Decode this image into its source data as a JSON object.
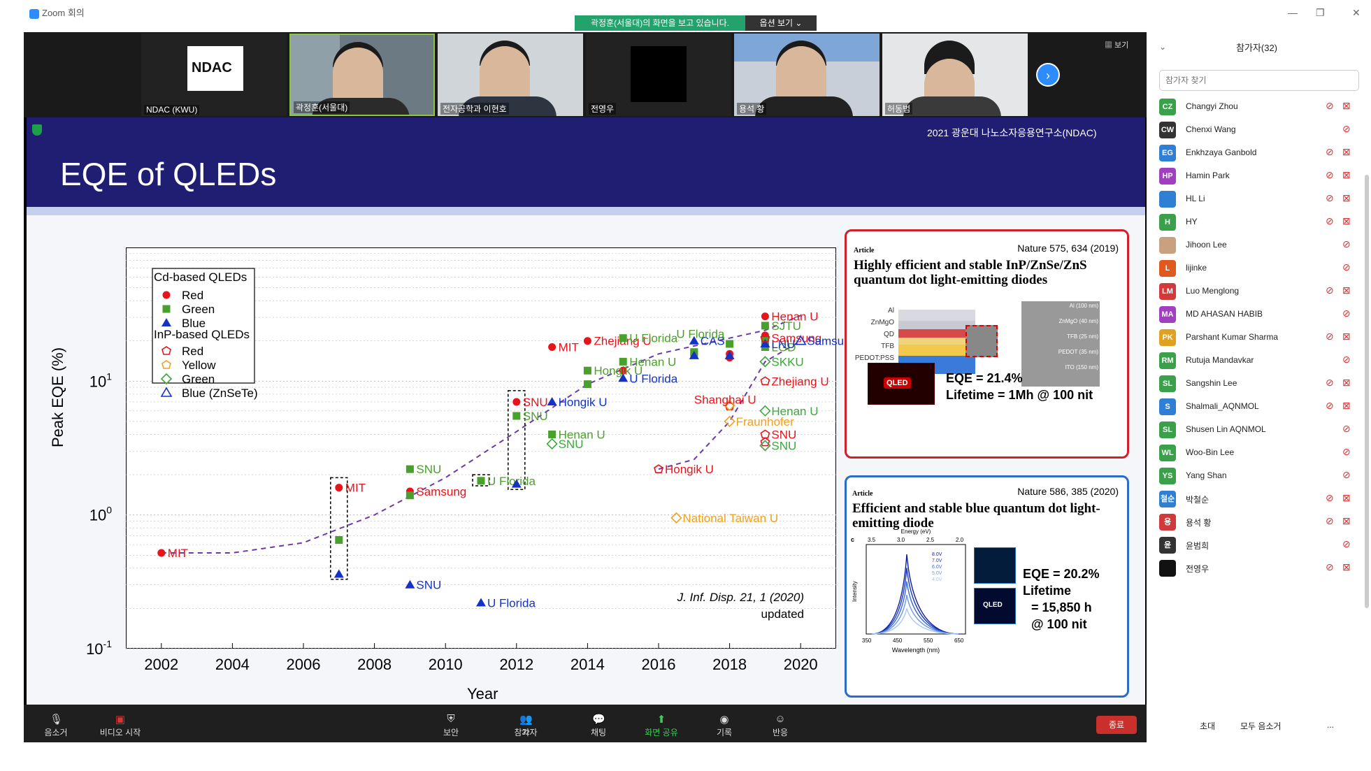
{
  "window": {
    "title": "Zoom 회의",
    "banner": "곽정훈(서울대)의 화면을 보고 있습니다.",
    "view_options": "옵션 보기 ⌄",
    "min": "—",
    "max": "❐",
    "close": "✕"
  },
  "gallery": {
    "view_label": "▦ 보기",
    "tiles": [
      {
        "name": "NDAC (KWU)",
        "logo": "NDAC"
      },
      {
        "name": "곽정훈(서울대)"
      },
      {
        "name": "전자공학과 이현호"
      },
      {
        "name": "전영우"
      },
      {
        "name": "용석 황"
      },
      {
        "name": "허동범"
      }
    ],
    "next": "›"
  },
  "slide": {
    "title": "EQE of QLEDs",
    "org": "2021 광운대 나노소자응용연구소(NDAC)"
  },
  "chart_data": {
    "type": "scatter",
    "xlabel": "Year",
    "ylabel": "Peak EQE (%)",
    "xlim": [
      2001,
      2021
    ],
    "xticks": [
      2002,
      2004,
      2006,
      2008,
      2010,
      2012,
      2014,
      2016,
      2018,
      2020
    ],
    "ylim": [
      0.1,
      100
    ],
    "log_y": true,
    "ytick_labels": [
      {
        "v": 10,
        "t": "10",
        "e": "1"
      },
      {
        "v": 1,
        "t": "10",
        "e": "0"
      },
      {
        "v": 0.1,
        "t": "10",
        "e": "-1"
      }
    ],
    "legend": {
      "title1": "Cd-based QLEDs",
      "cd": [
        "Red",
        "Green",
        "Blue"
      ],
      "title2": "InP-based QLEDs",
      "inp": [
        "Red",
        "Yellow",
        "Green"
      ],
      "extra": "Blue (ZnSeTe)"
    },
    "citation": "J. Inf. Disp. 21, 1 (2020)",
    "citation_note": "updated",
    "series": [
      {
        "name": "Red",
        "marker": "circle",
        "color": "#e8141c",
        "points": [
          [
            2002,
            0.52,
            "MIT"
          ],
          [
            2007,
            1.6,
            "MIT"
          ],
          [
            2009,
            1.5,
            "Samsung"
          ],
          [
            2012,
            7,
            "SNU"
          ],
          [
            2013,
            18,
            "MIT"
          ],
          [
            2014,
            20,
            "Zhejiang U"
          ],
          [
            2015,
            12,
            ""
          ],
          [
            2018,
            16,
            ""
          ],
          [
            2018,
            15,
            ""
          ],
          [
            2019,
            30.5,
            "Henan U"
          ],
          [
            2019,
            22,
            ""
          ]
        ]
      },
      {
        "name": "Green",
        "marker": "square",
        "color": "#4aa02c",
        "points": [
          [
            2007,
            0.65,
            ""
          ],
          [
            2009,
            1.4,
            ""
          ],
          [
            2009,
            2.2,
            "SNU"
          ],
          [
            2011,
            1.8,
            "U Florida"
          ],
          [
            2012,
            5.5,
            "SNU"
          ],
          [
            2013,
            4,
            "Henan U"
          ],
          [
            2014,
            12,
            "Hongik U"
          ],
          [
            2014,
            9.5,
            ""
          ],
          [
            2015,
            21,
            "U Florida"
          ],
          [
            2015,
            14,
            "Henan U"
          ],
          [
            2017,
            16,
            ""
          ],
          [
            2017,
            16.5,
            ""
          ],
          [
            2018,
            19,
            ""
          ],
          [
            2019,
            26,
            "SJTU"
          ],
          [
            2019,
            20,
            ""
          ],
          [
            2019,
            18,
            "LGD"
          ]
        ]
      },
      {
        "name": "Blue",
        "marker": "triangle",
        "color": "#1532c8",
        "points": [
          [
            2007,
            0.36,
            ""
          ],
          [
            2009,
            0.3,
            "SNU"
          ],
          [
            2011,
            0.22,
            "U Florida"
          ],
          [
            2012,
            1.7,
            ""
          ],
          [
            2013,
            7,
            "Hongik U"
          ],
          [
            2015,
            10.5,
            "U Florida"
          ],
          [
            2017,
            20,
            "CAS"
          ],
          [
            2017,
            15.5,
            ""
          ],
          [
            2018,
            15.5,
            ""
          ],
          [
            2019,
            19,
            "LNU"
          ]
        ]
      },
      {
        "name": "InP Red",
        "marker": "pentagon",
        "color": "#e8141c",
        "points": [
          [
            2016,
            2.2,
            "Hongik U"
          ],
          [
            2018,
            6.5,
            ""
          ],
          [
            2019,
            4,
            "SNU"
          ],
          [
            2019,
            3.5,
            ""
          ],
          [
            2019,
            10,
            "Zhejiang U"
          ],
          [
            2019,
            21,
            "Samsung"
          ]
        ]
      },
      {
        "name": "InP Yellow",
        "marker": "diamond",
        "color": "#f0a020",
        "points": [
          [
            2018,
            6.6,
            ""
          ],
          [
            2018,
            5,
            "Fraunhofer"
          ],
          [
            2016.5,
            0.95,
            "National Taiwan U"
          ]
        ]
      },
      {
        "name": "InP Green",
        "marker": "diamond",
        "color": "#3aa83a",
        "points": [
          [
            2013,
            3.4,
            "SNU"
          ],
          [
            2019,
            6,
            "Henan U"
          ],
          [
            2019,
            3.3,
            "SNU"
          ],
          [
            2019,
            14,
            "SKKU"
          ]
        ]
      },
      {
        "name": "Blue (ZnSeTe)",
        "marker": "open-triangle",
        "color": "#1532c8",
        "points": [
          [
            2020,
            20,
            "Samsung"
          ]
        ]
      }
    ],
    "text_labels": [
      {
        "text": "Shanghai U",
        "x": 2017,
        "y": 6.8,
        "color": "#e8141c"
      },
      {
        "text": "U Florida",
        "x": 2016.5,
        "y": 21,
        "color": "#4aa02c"
      }
    ]
  },
  "paper1": {
    "journal": "Nature 575, 634 (2019)",
    "tag": "Article",
    "title": "Highly efficient and stable InP/ZnSe/ZnS quantum dot light-emitting diodes",
    "layers": [
      "Al",
      "ZnMgO",
      "QD",
      "TFB",
      "PEDOT:PSS",
      "ITO"
    ],
    "tem": [
      "Al (100 nm)",
      "ZnMgO (40 nm)",
      "TFB (25 nm)",
      "PEDOT (35 nm)",
      "ITO (150 nm)"
    ],
    "eqe": "EQE = 21.4%",
    "life": "Lifetime = 1Mh @ 100 nit",
    "qled": "QLED"
  },
  "paper2": {
    "journal": "Nature 586, 385 (2020)",
    "tag": "Article",
    "title": "Efficient and stable blue quantum dot light-emitting diode",
    "xaxis": "Wavelength (nm)",
    "top": "Energy (eV)",
    "ylab": "Intensity",
    "panel": "c",
    "volts": [
      "8.0V",
      "7.0V",
      "6.0V",
      "5.0V",
      "4.0V"
    ],
    "eticks": [
      "3.5",
      "3.0",
      "2.5",
      "2.0"
    ],
    "wticks": [
      "350",
      "450",
      "550",
      "650"
    ],
    "eqe": "EQE = 20.2%",
    "l1": "Lifetime",
    "l2": "= 15,850 h",
    "l3": "@ 100 nit",
    "qled": "QLED"
  },
  "toolbar": {
    "mute": "음소거",
    "video": "비디오 시작",
    "security": "보안",
    "participants": "참가자",
    "pcount": "32",
    "chat": "채팅",
    "share": "화면 공유",
    "record": "기록",
    "reactions": "반응",
    "end": "종료"
  },
  "panel": {
    "title": "참가자(32)",
    "search_placeholder": "참가자 찾기",
    "invite": "초대",
    "mute_all": "모두 음소거",
    "more": "...",
    "people": [
      {
        "i": "CZ",
        "n": "Changyi Zhou",
        "c": "#3aa04a",
        "cam": true
      },
      {
        "i": "CW",
        "n": "Chenxi Wang",
        "c": "#333",
        "cam": false
      },
      {
        "i": "EG",
        "n": "Enkhzaya Ganbold",
        "c": "#2f7fd4",
        "cam": true
      },
      {
        "i": "HP",
        "n": "Hamin Park",
        "c": "#a040c0",
        "cam": true
      },
      {
        "i": "",
        "n": "HL Li",
        "c": "#2f7fd4",
        "cam": true
      },
      {
        "i": "H",
        "n": "HY",
        "c": "#3aa04a",
        "cam": true
      },
      {
        "i": "",
        "n": "Jihoon Lee",
        "c": "#c9a080",
        "cam": false
      },
      {
        "i": "L",
        "n": "lijinke",
        "c": "#e05a20",
        "cam": false
      },
      {
        "i": "LM",
        "n": "Luo Menglong",
        "c": "#d03a3a",
        "cam": true
      },
      {
        "i": "MA",
        "n": "MD AHASAN HABIB",
        "c": "#a040c0",
        "cam": false
      },
      {
        "i": "PK",
        "n": "Parshant Kumar Sharma",
        "c": "#e0a020",
        "cam": true
      },
      {
        "i": "RM",
        "n": "Rutuja Mandavkar",
        "c": "#3aa04a",
        "cam": false
      },
      {
        "i": "SL",
        "n": "Sangshin Lee",
        "c": "#3aa04a",
        "cam": true
      },
      {
        "i": "S",
        "n": "Shalmali_AQNMOL",
        "c": "#2f7fd4",
        "cam": true
      },
      {
        "i": "SL",
        "n": "Shusen Lin AQNMOL",
        "c": "#3aa04a",
        "cam": false
      },
      {
        "i": "WL",
        "n": "Woo-Bin Lee",
        "c": "#3aa04a",
        "cam": false
      },
      {
        "i": "YS",
        "n": "Yang Shan",
        "c": "#3aa04a",
        "cam": false
      },
      {
        "i": "철순",
        "n": "박철순",
        "c": "#2f7fd4",
        "cam": true
      },
      {
        "i": "용",
        "n": "용석 황",
        "c": "#d03a3a",
        "cam": true
      },
      {
        "i": "윤",
        "n": "윤범희",
        "c": "#333",
        "cam": false
      },
      {
        "i": "",
        "n": "전영우",
        "c": "#111",
        "cam": true
      }
    ]
  }
}
